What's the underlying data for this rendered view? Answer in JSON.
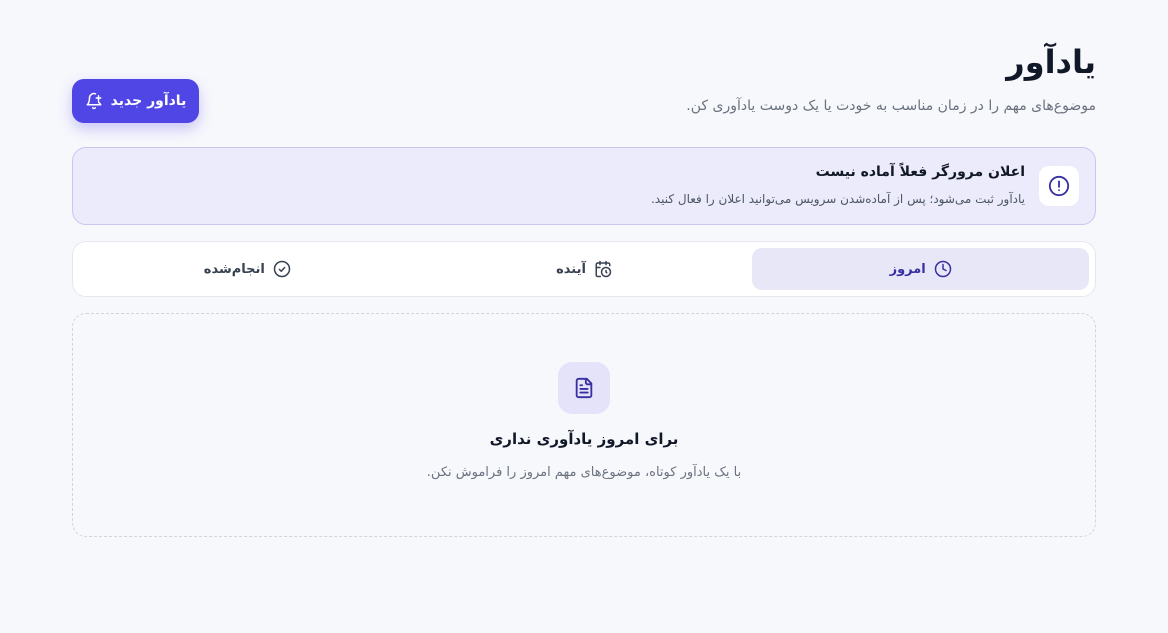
{
  "header": {
    "title": "یادآور",
    "subtitle": "موضوع‌های مهم را در زمان مناسب به خودت یا یک دوست یادآوری کن.",
    "new_button_label": "یادآور جدید",
    "new_button_icon": "bell-plus-icon"
  },
  "notice": {
    "icon": "alert-circle-icon",
    "title": "اعلان مرورگر فعلاً آماده نیست",
    "text": "یادآور ثبت می‌شود؛ پس از آماده‌شدن سرویس می‌توانید اعلان را فعال کنید."
  },
  "tabs": [
    {
      "label": "امروز",
      "icon": "clock-icon",
      "active": true
    },
    {
      "label": "آینده",
      "icon": "calendar-clock-icon",
      "active": false
    },
    {
      "label": "انجام‌شده",
      "icon": "check-circle-icon",
      "active": false
    }
  ],
  "empty_state": {
    "icon": "document-icon",
    "title": "برای امروز یادآوری نداری",
    "text": "با یک یادآور کوتاه، موضوع‌های مهم امروز را فراموش نکن."
  },
  "colors": {
    "accent": "#4f46e5",
    "background": "#f7f8fc",
    "notice_bg": "#ecebfb",
    "active_tab_bg": "#e8e7f8"
  }
}
